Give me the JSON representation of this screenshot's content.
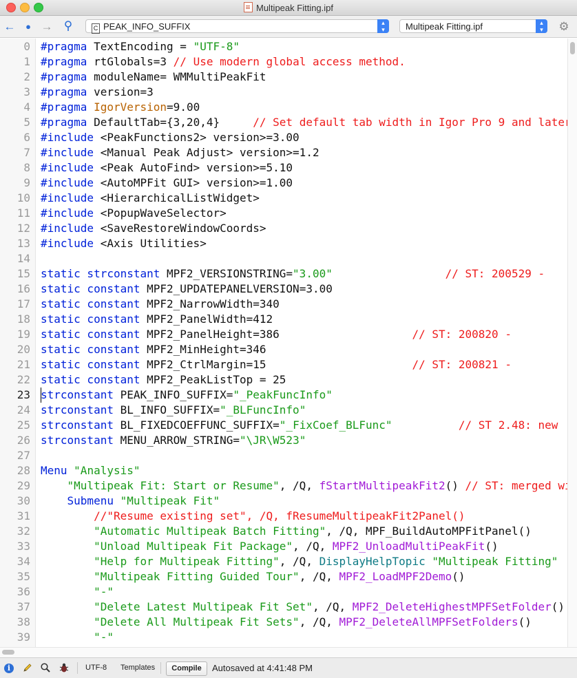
{
  "window": {
    "title": "Multipeak Fitting.ipf"
  },
  "toolbar": {
    "procedure_popup_value": "PEAK_INFO_SUFFIX",
    "procedure_popup_badge": "C",
    "file_popup_value": "Multipeak Fitting.ipf"
  },
  "editor": {
    "active_line": 23,
    "lines": [
      {
        "n": "0",
        "segs": [
          [
            "kw",
            "#pragma"
          ],
          [
            "tx",
            " TextEncoding = "
          ],
          [
            "str",
            "\"UTF-8\""
          ]
        ]
      },
      {
        "n": "1",
        "segs": [
          [
            "kw",
            "#pragma"
          ],
          [
            "tx",
            " rtGlobals=3 "
          ],
          [
            "cm",
            "// Use modern global access method."
          ]
        ]
      },
      {
        "n": "2",
        "segs": [
          [
            "kw",
            "#pragma"
          ],
          [
            "tx",
            " moduleName= WMMultiPeakFit"
          ]
        ]
      },
      {
        "n": "3",
        "segs": [
          [
            "kw",
            "#pragma"
          ],
          [
            "tx",
            " version=3"
          ]
        ]
      },
      {
        "n": "4",
        "segs": [
          [
            "kw",
            "#pragma"
          ],
          [
            "tx",
            " "
          ],
          [
            "ob",
            "IgorVersion"
          ],
          [
            "tx",
            "=9.00"
          ]
        ]
      },
      {
        "n": "5",
        "segs": [
          [
            "kw",
            "#pragma"
          ],
          [
            "tx",
            " DefaultTab={3,20,4}     "
          ],
          [
            "cm",
            "// Set default tab width in Igor Pro 9 and later"
          ]
        ]
      },
      {
        "n": "6",
        "segs": [
          [
            "kw",
            "#include"
          ],
          [
            "tx",
            " <PeakFunctions2> version>=3.00"
          ]
        ]
      },
      {
        "n": "7",
        "segs": [
          [
            "kw",
            "#include"
          ],
          [
            "tx",
            " <Manual Peak Adjust> version>=1.2"
          ]
        ]
      },
      {
        "n": "8",
        "segs": [
          [
            "kw",
            "#include"
          ],
          [
            "tx",
            " <Peak AutoFind> version>=5.10"
          ]
        ]
      },
      {
        "n": "9",
        "segs": [
          [
            "kw",
            "#include"
          ],
          [
            "tx",
            " <AutoMPFit GUI> version>=1.00"
          ]
        ]
      },
      {
        "n": "10",
        "segs": [
          [
            "kw",
            "#include"
          ],
          [
            "tx",
            " <HierarchicalListWidget>"
          ]
        ]
      },
      {
        "n": "11",
        "segs": [
          [
            "kw",
            "#include"
          ],
          [
            "tx",
            " <PopupWaveSelector>"
          ]
        ]
      },
      {
        "n": "12",
        "segs": [
          [
            "kw",
            "#include"
          ],
          [
            "tx",
            " <SaveRestoreWindowCoords>"
          ]
        ]
      },
      {
        "n": "13",
        "segs": [
          [
            "kw",
            "#include"
          ],
          [
            "tx",
            " <Axis Utilities>"
          ]
        ]
      },
      {
        "n": "14",
        "segs": []
      },
      {
        "n": "15",
        "segs": [
          [
            "kw",
            "static strconstant"
          ],
          [
            "tx",
            " MPF2_VERSIONSTRING="
          ],
          [
            "str",
            "\"3.00\""
          ],
          [
            "tx",
            "                 "
          ],
          [
            "cm",
            "// ST: 200529 -"
          ]
        ]
      },
      {
        "n": "16",
        "segs": [
          [
            "kw",
            "static constant"
          ],
          [
            "tx",
            " MPF2_UPDATEPANELVERSION=3.00"
          ]
        ]
      },
      {
        "n": "17",
        "segs": [
          [
            "kw",
            "static constant"
          ],
          [
            "tx",
            " MPF2_NarrowWidth=340"
          ]
        ]
      },
      {
        "n": "18",
        "segs": [
          [
            "kw",
            "static constant"
          ],
          [
            "tx",
            " MPF2_PanelWidth=412"
          ]
        ]
      },
      {
        "n": "19",
        "segs": [
          [
            "kw",
            "static constant"
          ],
          [
            "tx",
            " MPF2_PanelHeight=386                    "
          ],
          [
            "cm",
            "// ST: 200820 -"
          ]
        ]
      },
      {
        "n": "20",
        "segs": [
          [
            "kw",
            "static constant"
          ],
          [
            "tx",
            " MPF2_MinHeight=346"
          ]
        ]
      },
      {
        "n": "21",
        "segs": [
          [
            "kw",
            "static constant"
          ],
          [
            "tx",
            " MPF2_CtrlMargin=15                      "
          ],
          [
            "cm",
            "// ST: 200821 -"
          ]
        ]
      },
      {
        "n": "22",
        "segs": [
          [
            "kw",
            "static constant"
          ],
          [
            "tx",
            " MPF2_PeakListTop = 25"
          ]
        ]
      },
      {
        "n": "23",
        "segs": [
          [
            "kw",
            "strconstant"
          ],
          [
            "tx",
            " PEAK_INFO_SUFFIX="
          ],
          [
            "str",
            "\"_PeakFuncInfo\""
          ]
        ]
      },
      {
        "n": "24",
        "segs": [
          [
            "kw",
            "strconstant"
          ],
          [
            "tx",
            " BL_INFO_SUFFIX="
          ],
          [
            "str",
            "\"_BLFuncInfo\""
          ]
        ]
      },
      {
        "n": "25",
        "segs": [
          [
            "kw",
            "strconstant"
          ],
          [
            "tx",
            " BL_FIXEDCOEFFUNC_SUFFIX="
          ],
          [
            "str",
            "\"_FixCoef_BLFunc\""
          ],
          [
            "tx",
            "          "
          ],
          [
            "cm",
            "// ST 2.48: new"
          ]
        ]
      },
      {
        "n": "26",
        "segs": [
          [
            "kw",
            "strconstant"
          ],
          [
            "tx",
            " MENU_ARROW_STRING="
          ],
          [
            "str",
            "\"\\JR\\W523\""
          ]
        ]
      },
      {
        "n": "27",
        "segs": []
      },
      {
        "n": "28",
        "segs": [
          [
            "kw",
            "Menu"
          ],
          [
            "tx",
            " "
          ],
          [
            "str",
            "\"Analysis\""
          ]
        ]
      },
      {
        "n": "29",
        "segs": [
          [
            "tx",
            "    "
          ],
          [
            "str",
            "\"Multipeak Fit: Start or Resume\""
          ],
          [
            "tx",
            ", /Q, "
          ],
          [
            "fn",
            "fStartMultipeakFit2"
          ],
          [
            "tx",
            "() "
          ],
          [
            "cm",
            "// ST: merged wi"
          ]
        ]
      },
      {
        "n": "30",
        "segs": [
          [
            "tx",
            "    "
          ],
          [
            "kw",
            "Submenu"
          ],
          [
            "tx",
            " "
          ],
          [
            "str",
            "\"Multipeak Fit\""
          ]
        ]
      },
      {
        "n": "31",
        "segs": [
          [
            "tx",
            "        "
          ],
          [
            "cm",
            "//\"Resume existing set\", /Q, fResumeMultipeakFit2Panel()"
          ]
        ]
      },
      {
        "n": "32",
        "segs": [
          [
            "tx",
            "        "
          ],
          [
            "str",
            "\"Automatic Multipeak Batch Fitting\""
          ],
          [
            "tx",
            ", /Q, MPF_BuildAutoMPFitPanel()"
          ]
        ]
      },
      {
        "n": "33",
        "segs": [
          [
            "tx",
            "        "
          ],
          [
            "str",
            "\"Unload Multipeak Fit Package\""
          ],
          [
            "tx",
            ", /Q, "
          ],
          [
            "fn",
            "MPF2_UnloadMultiPeakFit"
          ],
          [
            "tx",
            "()"
          ]
        ]
      },
      {
        "n": "34",
        "segs": [
          [
            "tx",
            "        "
          ],
          [
            "str",
            "\"Help for Multipeak Fitting\""
          ],
          [
            "tx",
            ", /Q, "
          ],
          [
            "bi",
            "DisplayHelpTopic"
          ],
          [
            "tx",
            " "
          ],
          [
            "str",
            "\"Multipeak Fitting\""
          ]
        ]
      },
      {
        "n": "35",
        "segs": [
          [
            "tx",
            "        "
          ],
          [
            "str",
            "\"Multipeak Fitting Guided Tour\""
          ],
          [
            "tx",
            ", /Q, "
          ],
          [
            "fn",
            "MPF2_LoadMPF2Demo"
          ],
          [
            "tx",
            "()"
          ]
        ]
      },
      {
        "n": "36",
        "segs": [
          [
            "tx",
            "        "
          ],
          [
            "str",
            "\"-\""
          ]
        ]
      },
      {
        "n": "37",
        "segs": [
          [
            "tx",
            "        "
          ],
          [
            "str",
            "\"Delete Latest Multipeak Fit Set\""
          ],
          [
            "tx",
            ", /Q, "
          ],
          [
            "fn",
            "MPF2_DeleteHighestMPFSetFolder"
          ],
          [
            "tx",
            "()"
          ]
        ]
      },
      {
        "n": "38",
        "segs": [
          [
            "tx",
            "        "
          ],
          [
            "str",
            "\"Delete All Multipeak Fit Sets\""
          ],
          [
            "tx",
            ", /Q, "
          ],
          [
            "fn",
            "MPF2_DeleteAllMPFSetFolders"
          ],
          [
            "tx",
            "()"
          ]
        ]
      },
      {
        "n": "39",
        "segs": [
          [
            "tx",
            "        "
          ],
          [
            "str",
            "\"-\""
          ]
        ]
      }
    ]
  },
  "statusbar": {
    "encoding": "UTF-8",
    "templates": "Templates",
    "compile": "Compile",
    "autosaved": "Autosaved at 4:41:48 PM"
  },
  "icons": {
    "back": "arrow-left-icon",
    "history": "dot-icon",
    "forward": "arrow-right-icon",
    "pin": "pin-icon",
    "settings": "gear-icon"
  },
  "colors": {
    "keyword": "#0021d9",
    "string": "#1a9a1a",
    "comment": "#ee1c1c",
    "function": "#a11bd6",
    "builtin": "#0e7a84",
    "accent": "#3b82f6"
  }
}
